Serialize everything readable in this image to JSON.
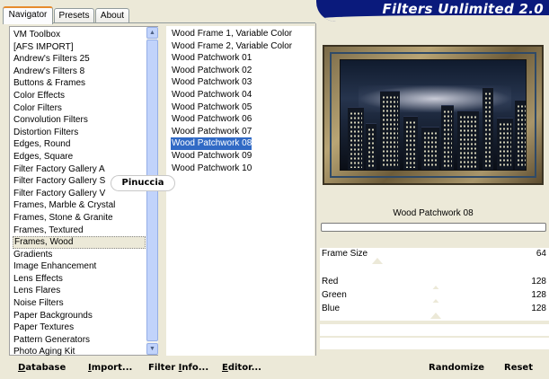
{
  "app": {
    "title": "Filters Unlimited 2.0"
  },
  "tabs": [
    {
      "label": "Navigator",
      "active": true
    },
    {
      "label": "Presets",
      "active": false
    },
    {
      "label": "About",
      "active": false
    }
  ],
  "categories": {
    "items": [
      "VM Toolbox",
      "[AFS IMPORT]",
      "Andrew's Filters 25",
      "Andrew's Filters 8",
      "Buttons & Frames",
      "Color Effects",
      "Color Filters",
      "Convolution Filters",
      "Distortion Filters",
      "Edges, Round",
      "Edges, Square",
      "Filter Factory Gallery A",
      "Filter Factory Gallery S",
      "Filter Factory Gallery V",
      "Frames, Marble & Crystal",
      "Frames, Stone & Granite",
      "Frames, Textured",
      "Frames, Wood",
      "Gradients",
      "Image Enhancement",
      "Lens Effects",
      "Lens Flares",
      "Noise Filters",
      "Paper Backgrounds",
      "Paper Textures",
      "Pattern Generators",
      "Photo Aging Kit"
    ],
    "selected": "Frames, Wood"
  },
  "filters": {
    "items": [
      "Wood Frame 1, Variable Color",
      "Wood Frame 2, Variable Color",
      "Wood Patchwork 01",
      "Wood Patchwork 02",
      "Wood Patchwork 03",
      "Wood Patchwork 04",
      "Wood Patchwork 05",
      "Wood Patchwork 06",
      "Wood Patchwork 07",
      "Wood Patchwork 08",
      "Wood Patchwork 09",
      "Wood Patchwork 10"
    ],
    "selected": "Wood Patchwork 08"
  },
  "watermark": "Pinuccia",
  "current_filter": "Wood Patchwork 08",
  "parameters": [
    {
      "name": "Frame Size",
      "value": "64"
    },
    {
      "name": "Red",
      "value": "128"
    },
    {
      "name": "Green",
      "value": "128"
    },
    {
      "name": "Blue",
      "value": "128"
    }
  ],
  "buttons": {
    "database": {
      "u": "D",
      "rest": "atabase"
    },
    "import": {
      "u": "I",
      "rest": "mport..."
    },
    "filter_info": {
      "pre": "Filter ",
      "u": "I",
      "rest": "nfo..."
    },
    "editor": {
      "u": "E",
      "rest": "ditor..."
    },
    "randomize": "Randomize",
    "reset": "Reset"
  },
  "icons": {
    "scroll_up": "chevron-up-icon",
    "scroll_down": "chevron-down-icon"
  }
}
